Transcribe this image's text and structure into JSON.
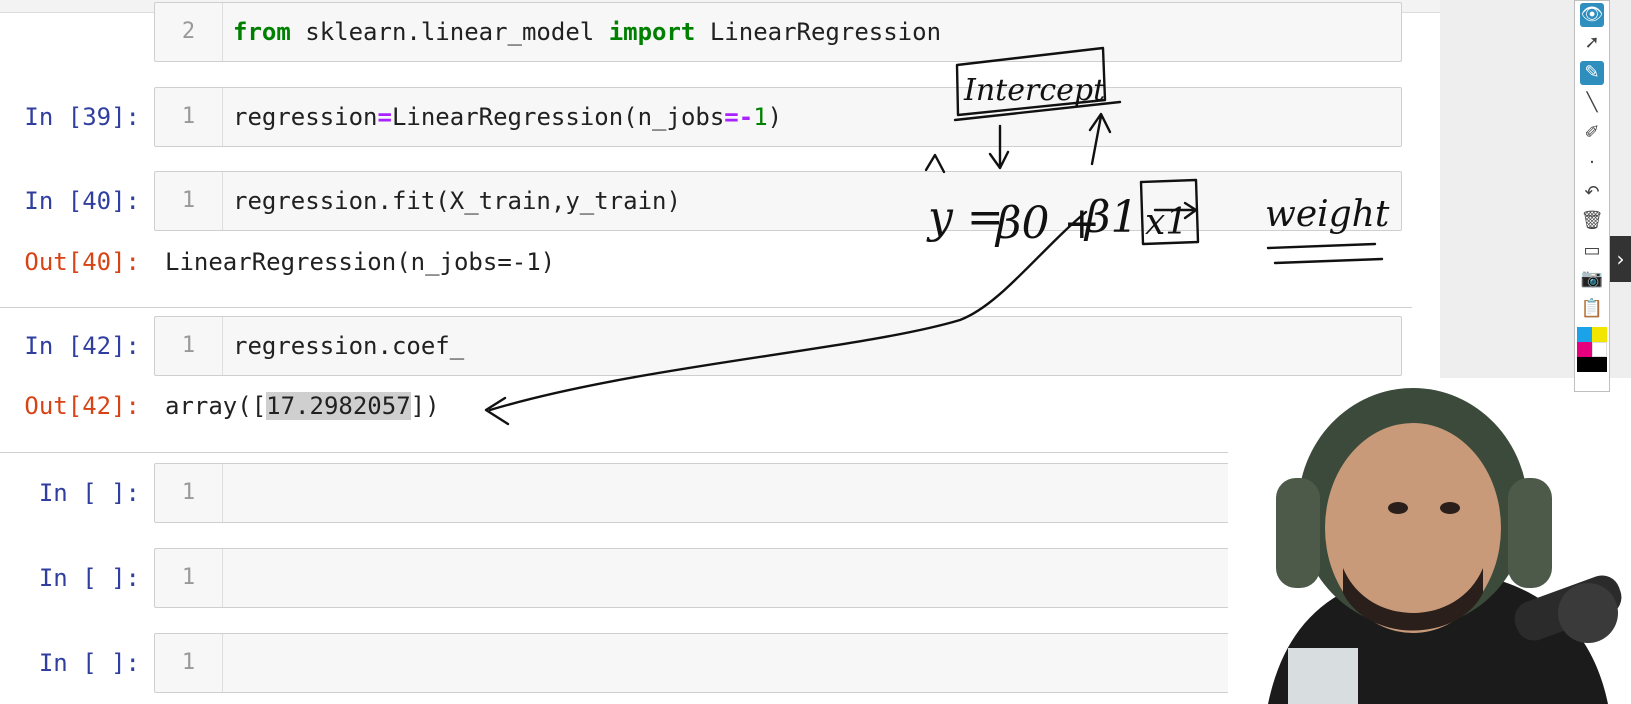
{
  "cells": [
    {
      "lineno": "2",
      "code": {
        "kw1": "from",
        "mod": " sklearn.linear_model ",
        "kw2": "import",
        "cls": " LinearRegression"
      }
    },
    {
      "prompt": "In [39]:",
      "lineno": "1",
      "code": {
        "a": "regression",
        "eq": "=",
        "b": "LinearRegression(n_jobs",
        "eq2": "=-",
        "num": "1",
        "c": ")"
      }
    },
    {
      "prompt": "In [40]:",
      "lineno": "1",
      "code": "regression.fit(X_train,y_train)",
      "out_prompt": "Out[40]:",
      "out": "LinearRegression(n_jobs=-1)"
    },
    {
      "prompt": "In [42]:",
      "lineno": "1",
      "code": "regression.coef_",
      "out_prompt": "Out[42]:",
      "out_pre": "array([",
      "out_val": "17.2982057",
      "out_post": "])"
    },
    {
      "prompt": "In [ ]:",
      "lineno": "1"
    },
    {
      "prompt": "In [ ]:",
      "lineno": "1"
    },
    {
      "prompt": "In [ ]:",
      "lineno": "1"
    }
  ],
  "annotation": {
    "intercept_label": "Intercept",
    "eq_lhs": "y =",
    "beta0": "β0 +",
    "beta1": "β1",
    "x1": "x1",
    "weight_label": "weight"
  },
  "toolbar": {
    "icons": [
      "eye-icon",
      "pointer-icon",
      "pen-icon",
      "line-icon",
      "eraser-icon",
      "dot-icon",
      "undo-icon",
      "trash-icon",
      "board-icon",
      "camera-icon",
      "clipboard-icon"
    ],
    "colors": [
      "#1aa3e8",
      "#f2e600",
      "#e6007e",
      "#ffffff",
      "#000000"
    ]
  },
  "collapse_glyph": "›"
}
